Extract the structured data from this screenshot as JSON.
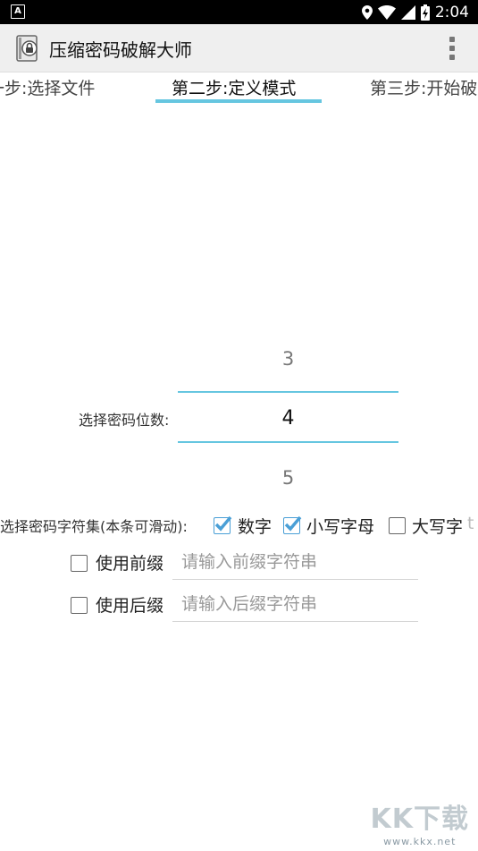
{
  "status_bar": {
    "time": "2:04",
    "left_icon": "a-notification-icon",
    "icons": [
      "location-icon",
      "wifi-icon",
      "signal-icon",
      "battery-charging-icon"
    ]
  },
  "app": {
    "title": "压缩密码破解大师",
    "icon": "zip-lock-icon",
    "menu_icon": "overflow-menu-icon"
  },
  "tabs": [
    {
      "label": "一步:选择文件",
      "selected": false
    },
    {
      "label": "第二步:定义模式",
      "selected": true
    },
    {
      "label": "第三步:开始破",
      "selected": false
    }
  ],
  "digit_picker": {
    "label": "选择密码位数:",
    "prev": "3",
    "current": "4",
    "next": "5"
  },
  "charset": {
    "label": "选择密码字符集(本条可滑动):",
    "options": [
      {
        "label": "数字",
        "checked": true
      },
      {
        "label": "小写字母",
        "checked": true
      },
      {
        "label": "大写字",
        "checked": false
      }
    ],
    "overflow_text": "t"
  },
  "prefix": {
    "label": "使用前缀",
    "checked": false,
    "placeholder": "请输入前缀字符串",
    "value": ""
  },
  "suffix": {
    "label": "使用后缀",
    "checked": false,
    "placeholder": "请输入后缀字符串",
    "value": ""
  },
  "watermark": {
    "main": "KK下载",
    "sub": "www.kkx.net"
  },
  "colors": {
    "accent": "#66c6e0",
    "checkbox_check": "#4a9fd6",
    "toolbar_bg": "#efefef"
  }
}
